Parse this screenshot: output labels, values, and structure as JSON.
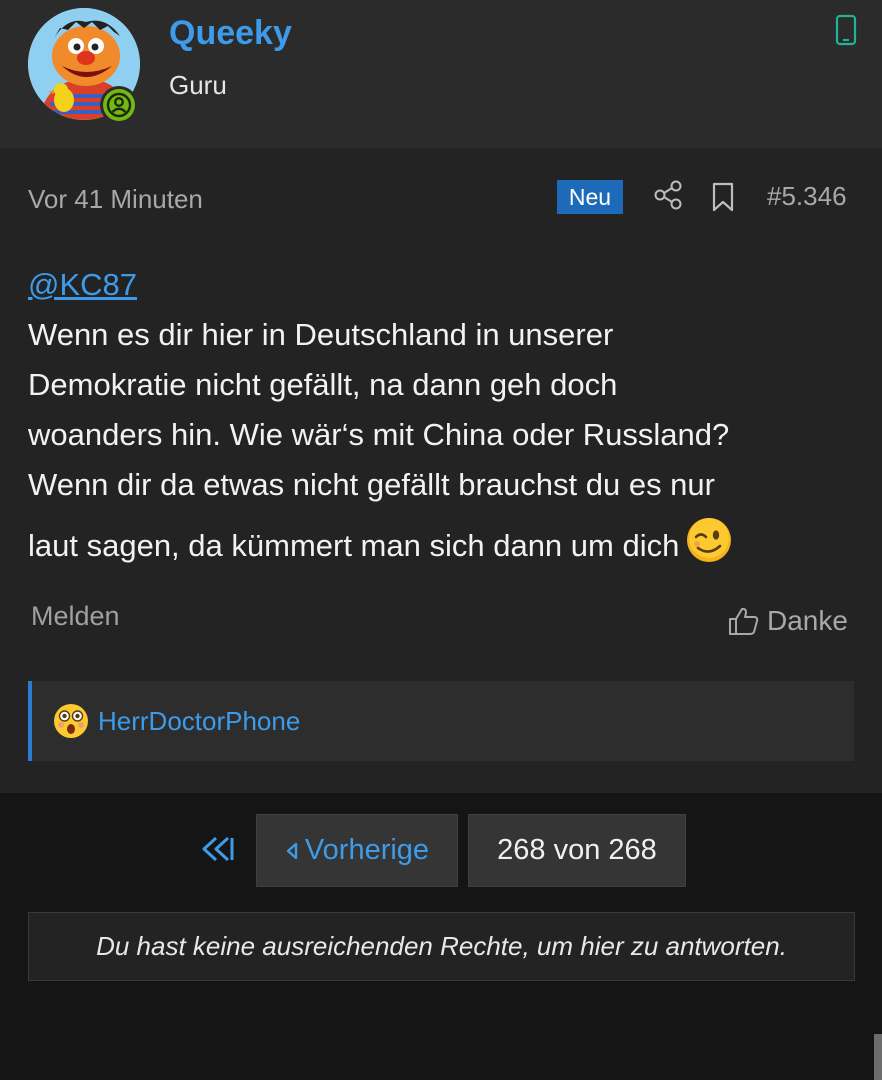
{
  "user": {
    "name": "Queeky",
    "title": "Guru",
    "online": true
  },
  "post": {
    "time": "Vor 41 Minuten",
    "new_badge": "Neu",
    "number": "#5.346",
    "mention": "@KC87",
    "lines": [
      "Wenn es dir hier in Deutschland in unserer",
      "Demokratie nicht gefällt, na dann geh doch",
      "woanders hin. Wie wär‘s mit China oder Russland?",
      "Wenn dir da etwas nicht gefällt brauchst du es nur",
      "laut sagen, da kümmert man sich dann um dich"
    ],
    "report_label": "Melden",
    "thanks_label": "Danke",
    "reactions": [
      {
        "user": "HerrDoctorPhone",
        "emoji": "astonished-face-icon"
      }
    ]
  },
  "pagination": {
    "prev_label": "Vorherige",
    "page_indicator": "268 von 268"
  },
  "notice": "Du hast keine ausreichenden Rechte, um hier zu antworten.",
  "colors": {
    "accent": "#3d9be9",
    "badge": "#1d6bb8",
    "online": "#74b816",
    "device": "#1fb39a"
  }
}
